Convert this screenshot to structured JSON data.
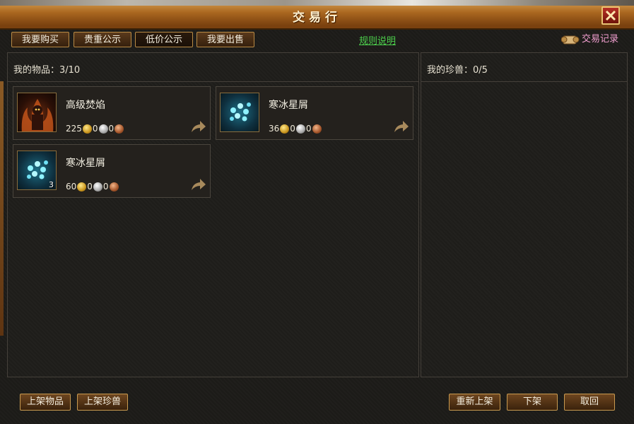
{
  "window": {
    "title": "交易行"
  },
  "tabs": [
    {
      "label": "我要购买"
    },
    {
      "label": "贵重公示"
    },
    {
      "label": "低价公示"
    },
    {
      "label": "我要出售"
    }
  ],
  "rules_link": "规则说明",
  "trade_record": "交易记录",
  "left_panel": {
    "header": "我的物品：3/10",
    "items": [
      {
        "name": "高级焚焰",
        "gold": "225",
        "silver": "0",
        "copper": "0",
        "icon": "fire-demon-icon"
      },
      {
        "name": "寒冰星屑",
        "gold": "36",
        "silver": "0",
        "copper": "0",
        "icon": "ice-stardust-icon"
      },
      {
        "name": "寒冰星屑",
        "gold": "60",
        "silver": "0",
        "copper": "0",
        "icon": "ice-stardust-icon",
        "count": "3"
      }
    ]
  },
  "right_panel": {
    "header": "我的珍兽：0/5"
  },
  "bottom": {
    "list_item": "上架物品",
    "list_pet": "上架珍兽",
    "relist": "重新上架",
    "delist": "下架",
    "cancel": "取回"
  },
  "colors": {
    "accent": "#b88a45",
    "link_green": "#4ccf4c",
    "record_pink": "#f29fd0"
  }
}
